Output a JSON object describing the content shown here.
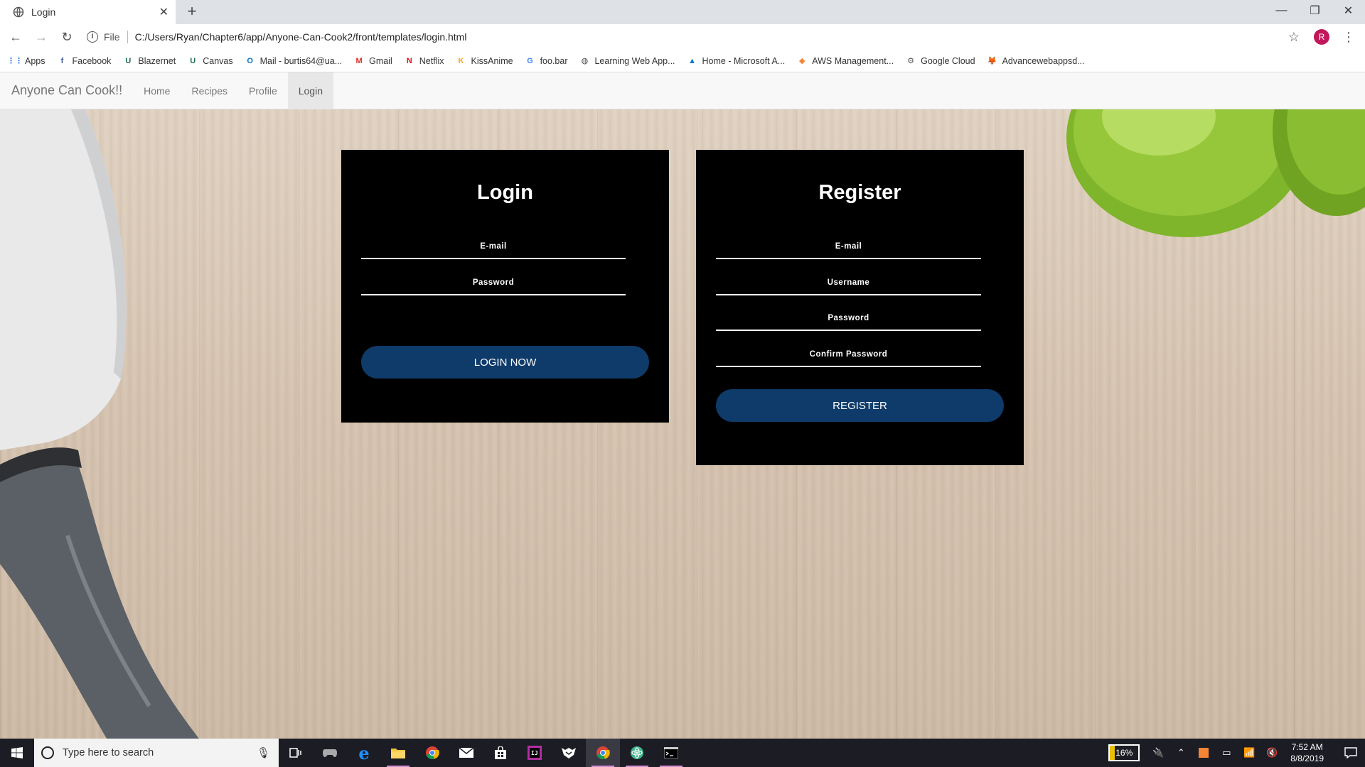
{
  "browser": {
    "tab_title": "Login",
    "address_scheme": "File",
    "address_url": "C:/Users/Ryan/Chapter6/app/Anyone-Can-Cook2/front/templates/login.html",
    "avatar_letter": "R"
  },
  "bookmarks": [
    {
      "label": "Apps",
      "icon": "apps-grid-icon",
      "color": "#4285f4"
    },
    {
      "label": "Facebook",
      "icon": "facebook-icon",
      "color": "#3b5998"
    },
    {
      "label": "Blazernet",
      "icon": "uab-icon",
      "color": "#1e6b52"
    },
    {
      "label": "Canvas",
      "icon": "uab-icon",
      "color": "#1e6b52"
    },
    {
      "label": "Mail - burtis64@ua...",
      "icon": "outlook-icon",
      "color": "#0072c6"
    },
    {
      "label": "Gmail",
      "icon": "gmail-icon",
      "color": "#d93025"
    },
    {
      "label": "Netflix",
      "icon": "netflix-icon",
      "color": "#e50914"
    },
    {
      "label": "KissAnime",
      "icon": "kissanime-icon",
      "color": "#f5a623"
    },
    {
      "label": "foo.bar",
      "icon": "google-icon",
      "color": "#4285f4"
    },
    {
      "label": "Learning Web App...",
      "icon": "globe-icon",
      "color": "#444444"
    },
    {
      "label": "Home - Microsoft A...",
      "icon": "azure-icon",
      "color": "#0078d4"
    },
    {
      "label": "AWS Management...",
      "icon": "aws-icon",
      "color": "#f58536"
    },
    {
      "label": "Google Cloud",
      "icon": "gear-icon",
      "color": "#555555"
    },
    {
      "label": "Advancewebappsd...",
      "icon": "gitlab-icon",
      "color": "#e24329"
    }
  ],
  "navbar": {
    "brand": "Anyone Can Cook!!",
    "links": [
      "Home",
      "Recipes",
      "Profile",
      "Login"
    ],
    "active": "Login"
  },
  "login": {
    "title": "Login",
    "email": "E-mail",
    "password": "Password",
    "button": "LOGIN NOW"
  },
  "register": {
    "title": "Register",
    "email": "E-mail",
    "username": "Username",
    "password": "Password",
    "confirm": "Confirm Password",
    "button": "REGISTER"
  },
  "taskbar": {
    "search_placeholder": "Type here to search",
    "battery": "16%",
    "time": "7:52 AM",
    "date": "8/8/2019"
  },
  "colors": {
    "button": "#0f3b6a",
    "card": "#000000"
  }
}
